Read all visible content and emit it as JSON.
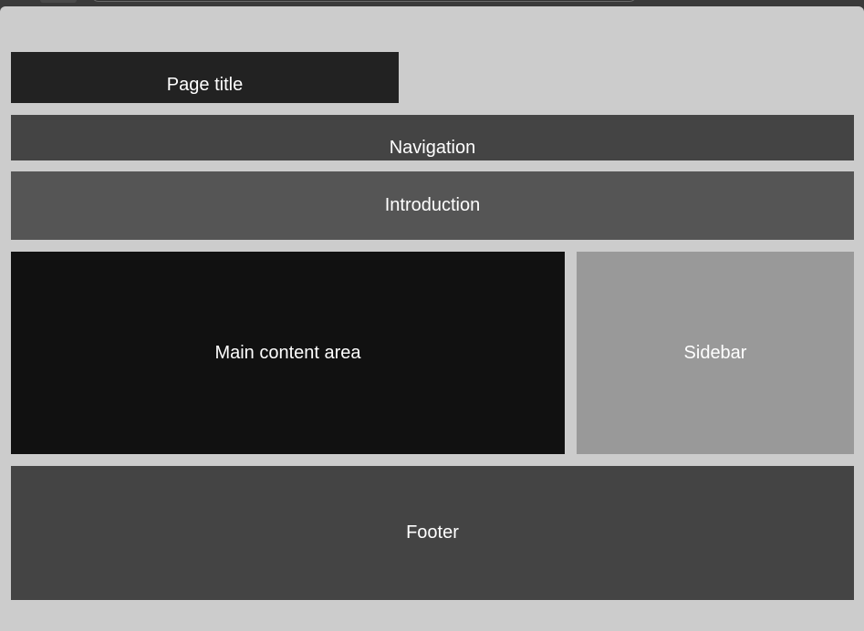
{
  "page": {
    "title": "Page title",
    "navigation": "Navigation",
    "introduction": "Introduction",
    "main_content": "Main content area",
    "sidebar": "Sidebar",
    "footer": "Footer"
  },
  "colors": {
    "page_background": "#cccccc",
    "title_block": "#222222",
    "navigation_block": "#444444",
    "introduction_block": "#555555",
    "main_block": "#111111",
    "sidebar_block": "#999999",
    "footer_block": "#444444",
    "text": "#ffffff"
  }
}
